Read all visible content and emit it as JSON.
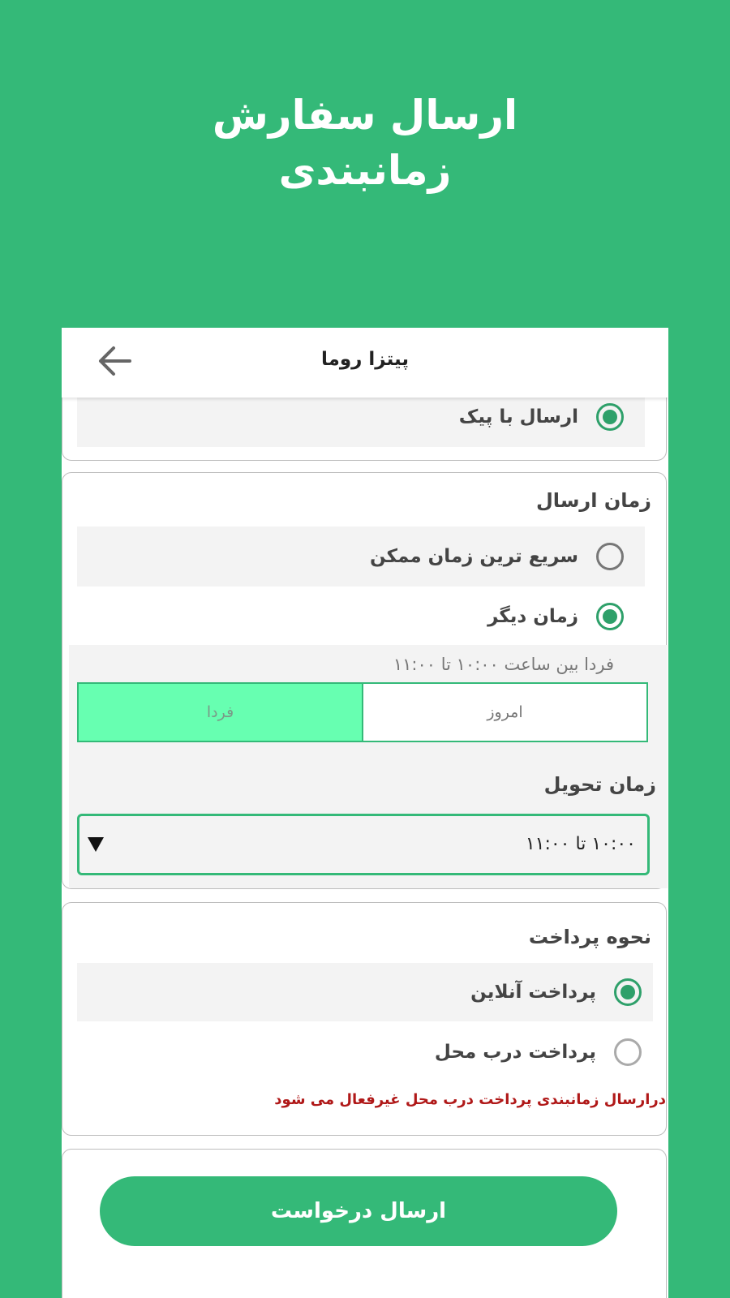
{
  "hero": {
    "line1": "ارسال سفارش",
    "line2": "زمانبندی"
  },
  "appbar": {
    "title": "پیتزا روما",
    "back_icon": "arrow-left-icon"
  },
  "delivery_method": {
    "option_courier": "ارسال با پیک",
    "selected": true
  },
  "send_time": {
    "title": "زمان ارسال",
    "option_fastest": "سریع ترین زمان ممکن",
    "option_other": "زمان دیگر",
    "selected": "option_other",
    "hint": "فردا بین ساعت ۱۰:۰۰ تا ۱۱:۰۰",
    "day_tabs": {
      "today": "امروز",
      "tomorrow": "فردا",
      "active": "tomorrow"
    },
    "delivery_time_title": "زمان تحویل",
    "delivery_time_value": "۱۰:۰۰ تا ۱۱:۰۰"
  },
  "payment": {
    "title": "نحوه پرداخت",
    "option_online": "پرداخت آنلاین",
    "option_cod": "پرداخت درب محل",
    "selected": "option_online",
    "warning": "درارسال زمانبندی پرداخت درب محل غیرفعال می شود"
  },
  "submit_label": "ارسال درخواست",
  "colors": {
    "brand": "#34b978",
    "active_tab": "#67ffb1",
    "warning": "#b01818"
  }
}
